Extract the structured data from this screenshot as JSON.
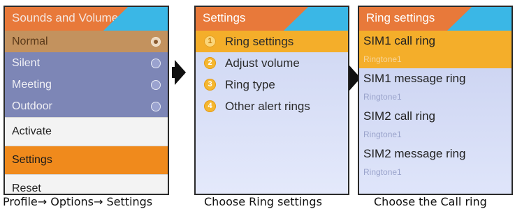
{
  "screen1": {
    "title": "Sounds and Volume",
    "profiles": [
      {
        "label": "Normal",
        "selected": true
      },
      {
        "label": "Silent",
        "selected": false
      },
      {
        "label": "Meeting",
        "selected": false
      },
      {
        "label": "Outdoor",
        "selected": false
      }
    ],
    "menu": [
      {
        "label": "Activate",
        "selected": false
      },
      {
        "label": "Settings",
        "selected": true
      },
      {
        "label": "Reset",
        "selected": false
      }
    ]
  },
  "screen2": {
    "title": "Settings",
    "items": [
      {
        "num": "1",
        "label": "Ring settings",
        "selected": true
      },
      {
        "num": "2",
        "label": "Adjust volume",
        "selected": false
      },
      {
        "num": "3",
        "label": "Ring type",
        "selected": false
      },
      {
        "num": "4",
        "label": "Other alert rings",
        "selected": false
      }
    ]
  },
  "screen3": {
    "title": "Ring settings",
    "items": [
      {
        "label": "SIM1 call ring",
        "value": "Ringtone1",
        "selected": true
      },
      {
        "label": "SIM1 message ring",
        "value": "Ringtone1",
        "selected": false
      },
      {
        "label": "SIM2 call ring",
        "value": "Ringtone1",
        "selected": false
      },
      {
        "label": "SIM2 message ring",
        "value": "Ringtone1",
        "selected": false
      }
    ]
  },
  "captions": {
    "step1": "Profile→ Options→ Settings",
    "step2": "Choose Ring settings",
    "step3": "Choose the Call ring"
  },
  "colors": {
    "header": "#e8793a",
    "header_tab": "#3ab7e6",
    "highlight": "#f4ae2a"
  }
}
